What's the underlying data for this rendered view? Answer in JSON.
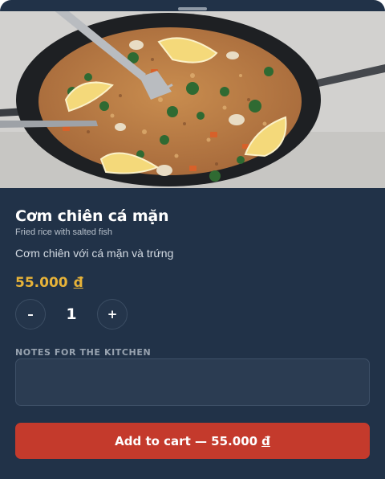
{
  "dish": {
    "image_alt": "Fried rice with salted fish in a black pan with lemon wedges and a fork",
    "name": "Cơm chiên cá mặn",
    "subtitle": "Fried rice with salted fish",
    "description": "Cơm chiên với cá mặn và trứng",
    "price": "55.000",
    "currency": "đ"
  },
  "quantity": {
    "decrement_label": "–",
    "value": "1",
    "increment_label": "+"
  },
  "notes": {
    "label": "NOTES FOR THE KITCHEN",
    "value": "",
    "placeholder": ""
  },
  "cart_button": {
    "label_prefix": "Add to cart — 55.000",
    "currency": "đ"
  },
  "colors": {
    "panel": "#213248",
    "price": "#e7b339",
    "cart_button": "#c43a2c"
  }
}
